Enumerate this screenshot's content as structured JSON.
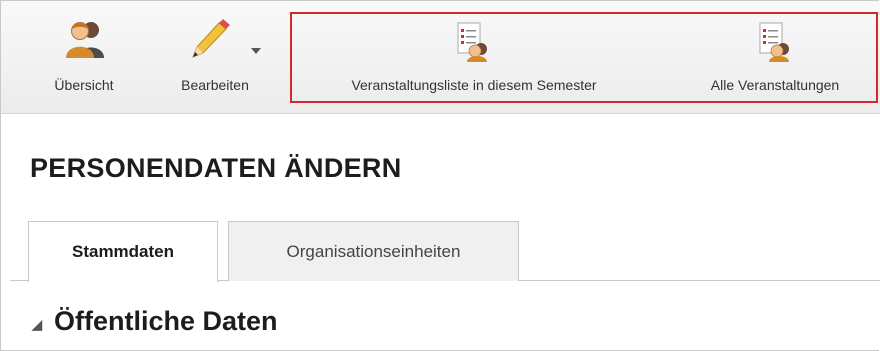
{
  "toolbar": {
    "buttons": [
      {
        "label": "Übersicht",
        "icon": "users-icon"
      },
      {
        "label": "Bearbeiten",
        "icon": "pencil-icon"
      },
      {
        "label": "Veranstaltungsliste in diesem Semester",
        "icon": "event-list-icon"
      },
      {
        "label": "Alle Veranstaltungen",
        "icon": "event-list-icon"
      }
    ],
    "highlight_color": "#d6262e"
  },
  "page": {
    "title": "PERSONENDATEN ÄNDERN"
  },
  "tabs": [
    {
      "label": "Stammdaten",
      "active": true
    },
    {
      "label": "Organisationseinheiten",
      "active": false
    }
  ],
  "section": {
    "title": "Öffentliche Daten",
    "expander_icon": "triangle-down-icon"
  }
}
